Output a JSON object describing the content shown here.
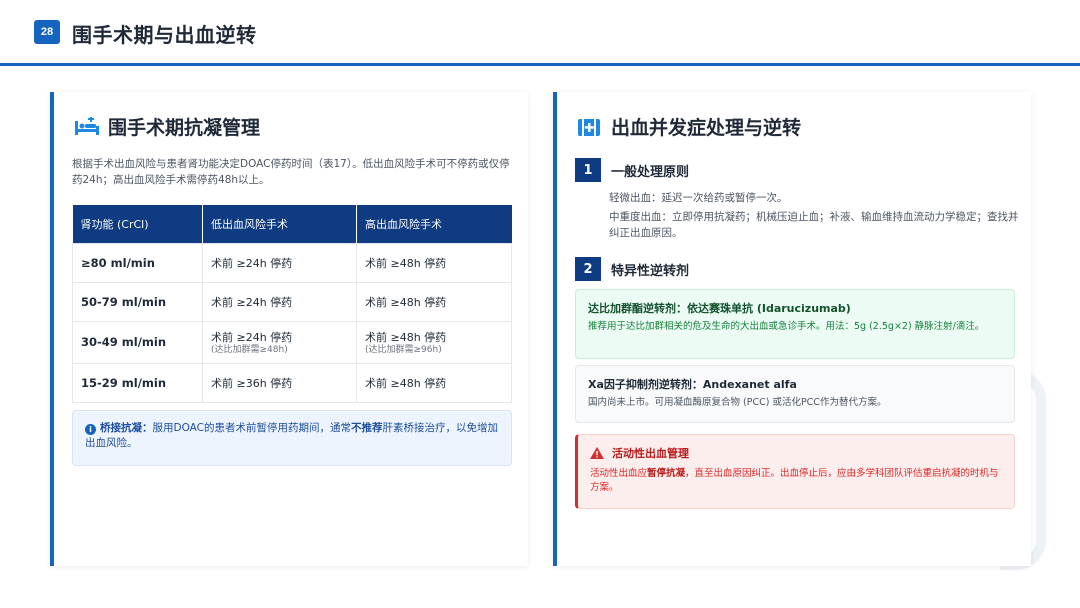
{
  "header": {
    "page_number": "28",
    "title": "围手术期与出血逆转"
  },
  "left": {
    "icon": "hospital-bed-icon",
    "title": "围手术期抗凝管理",
    "intro": "根据手术出血风险与患者肾功能决定DOAC停药时间（表17）。低出血风险手术可不停药或仅停药24h；高出血风险手术需停药48h以上。",
    "table": {
      "headers": [
        "肾功能 (CrCl)",
        "低出血风险手术",
        "高出血风险手术"
      ],
      "rows": [
        {
          "crcl": "≥80 ml/min",
          "low": "术前 ≥24h 停药",
          "low_note": "",
          "high": "术前 ≥48h 停药",
          "high_note": ""
        },
        {
          "crcl": "50-79 ml/min",
          "low": "术前 ≥24h 停药",
          "low_note": "",
          "high": "术前 ≥48h 停药",
          "high_note": ""
        },
        {
          "crcl": "30-49 ml/min",
          "low": "术前 ≥24h 停药",
          "low_note": "(达比加群需≥48h)",
          "high": "术前 ≥48h 停药",
          "high_note": "(达比加群需≥96h)"
        },
        {
          "crcl": "15-29 ml/min",
          "low": "术前 ≥36h 停药",
          "low_note": "",
          "high": "术前 ≥48h 停药",
          "high_note": ""
        }
      ]
    },
    "note": {
      "icon": "info-icon",
      "label": "桥接抗凝：",
      "text_before": "服用DOAC的患者术前暂停用药期间，通常",
      "emphasis": "不推荐",
      "text_after": "肝素桥接治疗，以免增加出血风险。"
    }
  },
  "right": {
    "icon": "first-aid-kit-icon",
    "title": "出血并发症处理与逆转",
    "step1": {
      "num": "1",
      "label": "一般处理原则"
    },
    "principles": [
      "轻微出血：延迟一次给药或暂停一次。",
      "中重度出血：立即停用抗凝药；机械压迫止血；补液、输血维持血流动力学稳定；查找并纠正出血原因。"
    ],
    "step2": {
      "num": "2",
      "label": "特异性逆转剂"
    },
    "card_green": {
      "title": "达比加群酯逆转剂：依达赛珠单抗 (Idarucizumab)",
      "body": "推荐用于达比加群相关的危及生命的大出血或急诊手术。用法：5g (2.5g×2) 静脉注射/滴注。"
    },
    "card_gray": {
      "title": "Xa因子抑制剂逆转剂：Andexanet alfa",
      "body": "国内尚未上市。可用凝血酶原复合物 (PCC) 或活化PCC作为替代方案。"
    },
    "card_red": {
      "icon": "warning-icon",
      "title": "活动性出血管理",
      "body_before": "活动性出血应",
      "emphasis": "暂停抗凝",
      "body_after": "，直至出血原因纠正。出血停止后，应由多学科团队评估重启抗凝的时机与方案。"
    }
  },
  "colors": {
    "primary": "#1565c0",
    "table_header": "#0f3b82",
    "green_bg": "#ecfbf3",
    "red_accent": "#d32f2f"
  }
}
